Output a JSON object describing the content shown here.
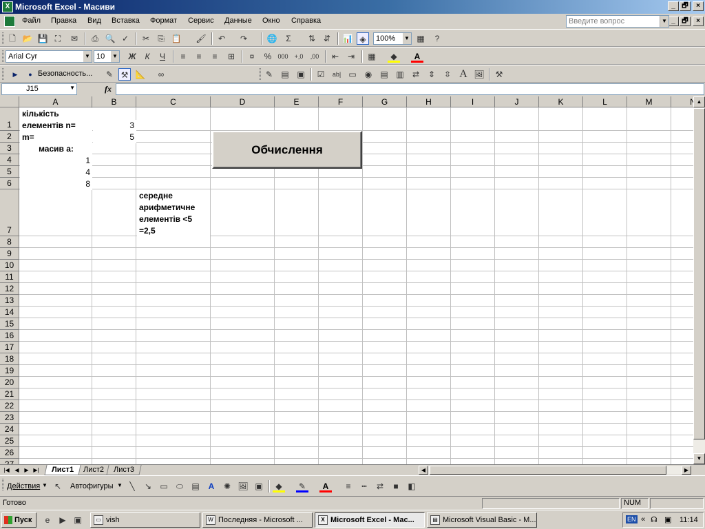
{
  "window": {
    "title": "Microsoft Excel - Масиви",
    "app_icon": "X",
    "caption_min": "_",
    "caption_restore": "🗗",
    "caption_close": "×"
  },
  "menu": {
    "items": [
      "Файл",
      "Правка",
      "Вид",
      "Вставка",
      "Формат",
      "Сервис",
      "Данные",
      "Окно",
      "Справка"
    ],
    "ask_placeholder": "Введите вопрос"
  },
  "toolbar_std": {
    "zoom": "100%"
  },
  "toolbar_fmt": {
    "font": "Arial Cyr",
    "size": "10",
    "bold": "Ж",
    "italic": "К",
    "underline": "Ч"
  },
  "toolbar_vb": {
    "security_label": "Безопасность..."
  },
  "formula_bar": {
    "name_box": "J15",
    "fx": "fx",
    "formula": ""
  },
  "sheet": {
    "columns": [
      "A",
      "B",
      "C",
      "D",
      "E",
      "F",
      "G",
      "H",
      "I",
      "J",
      "K",
      "L",
      "M",
      "N"
    ],
    "rows": [
      "1",
      "2",
      "3",
      "4",
      "5",
      "6",
      "7",
      "8",
      "9",
      "10",
      "11",
      "12",
      "13",
      "14",
      "15",
      "16",
      "17",
      "18",
      "19",
      "20",
      "21",
      "22",
      "23",
      "24",
      "25",
      "26",
      "27"
    ],
    "cells": {
      "a1": "кількість елементів n=",
      "b1": "3",
      "a2": "m=",
      "b2": "5",
      "a3": "масив a:",
      "a4": "1",
      "a5": "4",
      "a6": "8",
      "c7": "середне арифметичне елементів <5 =2,5"
    },
    "button_label": "Обчислення"
  },
  "tabs": {
    "items": [
      "Лист1",
      "Лист2",
      "Лист3"
    ],
    "active": "Лист1"
  },
  "draw_toolbar": {
    "actions": "Действия",
    "autoshapes": "Автофигуры"
  },
  "status": {
    "ready": "Готово",
    "num": "NUM"
  },
  "taskbar": {
    "start": "Пуск",
    "folder": "vish",
    "tasks": [
      "Последняя - Microsoft ...",
      "Microsoft Excel - Мас...",
      "Microsoft Visual Basic - M..."
    ],
    "lang": "EN",
    "clock": "11:14"
  }
}
